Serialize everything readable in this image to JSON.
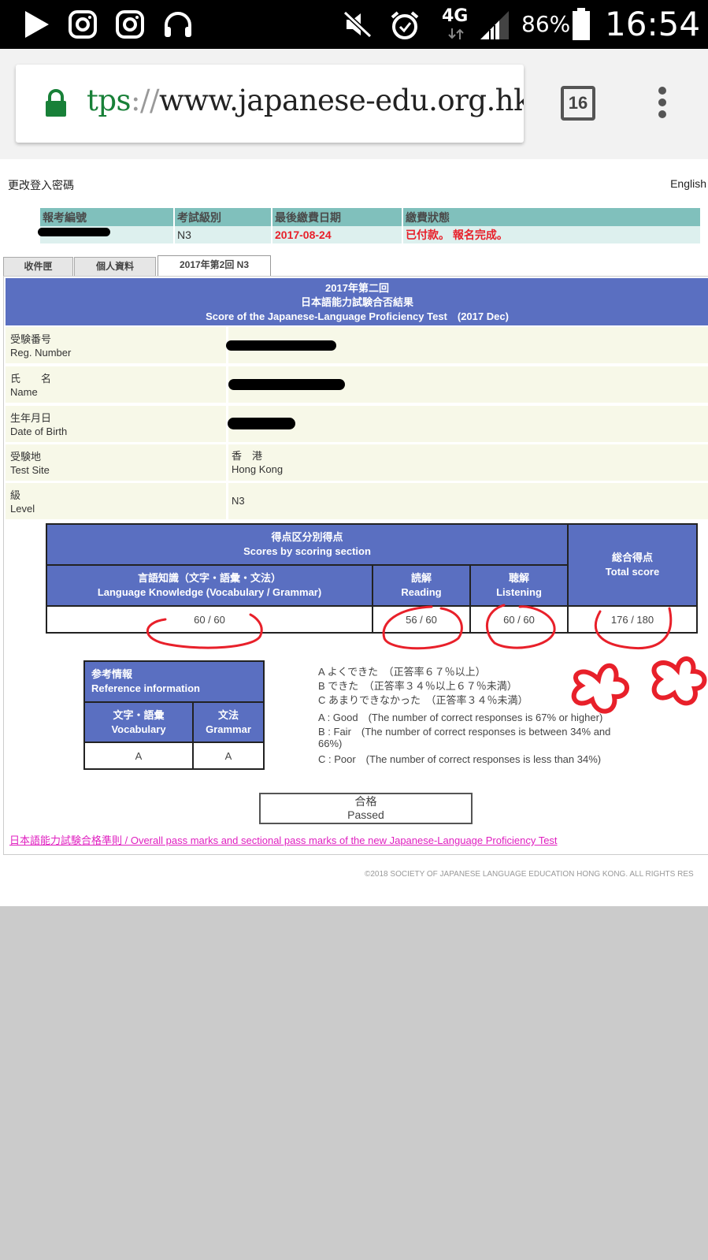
{
  "status_bar": {
    "time": "16:54",
    "battery": "86%",
    "network": "4G"
  },
  "browser": {
    "url_scheme": "tps",
    "url_sep": "://",
    "url_host": "www.japanese-edu.org.hk",
    "tab_count": "16"
  },
  "nav": {
    "change_password": "更改登入密碼",
    "language": "English"
  },
  "summary": {
    "headers": [
      "報考編號",
      "考試級別",
      "最後繳費日期",
      "繳費狀態"
    ],
    "level": "N3",
    "due_date": "2017-08-24",
    "status": "已付款。 報名完成。"
  },
  "tabs": [
    "收件匣",
    "個人資料",
    "2017年第2回 N3"
  ],
  "result": {
    "title_line1": "2017年第二回",
    "title_line2": "日本語能力試験合否結果",
    "title_line3": "Score of the Japanese-Language Proficiency Test　(2017 Dec)",
    "rows": [
      {
        "label_jp": "受験番号",
        "label_en": "Reg. Number",
        "value_1": "",
        "value_2": ""
      },
      {
        "label_jp": "氏　　名",
        "label_en": "Name",
        "value_1": "",
        "value_2": ""
      },
      {
        "label_jp": "生年月日",
        "label_en": "Date of Birth",
        "value_1": "",
        "value_2": ""
      },
      {
        "label_jp": "受験地",
        "label_en": "Test Site",
        "value_1": "香　港",
        "value_2": "Hong Kong"
      },
      {
        "label_jp": "級",
        "label_en": "Level",
        "value_1": "N3",
        "value_2": ""
      }
    ]
  },
  "scores": {
    "section_header_jp": "得点区分別得点",
    "section_header_en": "Scores by scoring section",
    "total_header_jp": "総合得点",
    "total_header_en": "Total score",
    "lang_jp": "言語知識（文字・語彙・文法）",
    "lang_en": "Language Knowledge (Vocabulary / Grammar)",
    "reading_jp": "読解",
    "reading_en": "Reading",
    "listening_jp": "聴解",
    "listening_en": "Listening",
    "lang_score": "60 / 60",
    "reading_score": "56 / 60",
    "listening_score": "60 / 60",
    "total_score": "176 / 180"
  },
  "reference": {
    "header_jp": "参考情報",
    "header_en": "Reference information",
    "vocab_jp": "文字・語彙",
    "vocab_en": "Vocabulary",
    "grammar_jp": "文法",
    "grammar_en": "Grammar",
    "vocab_grade": "A",
    "grammar_grade": "A"
  },
  "legend": {
    "jp_a": "A よくできた　（正答率６７％以上）",
    "jp_b": "B できた　（正答率３４％以上６７％未満）",
    "jp_c": "C あまりできなかった　（正答率３４％未満）",
    "en_a": "A : Good　(The number of correct responses is 67% or higher)",
    "en_b1": "B : Fair　(The number of correct responses is between 34% and",
    "en_b2": "66%)",
    "en_c": "C : Poor　(The number of correct responses is less than 34%)"
  },
  "pass": {
    "jp": "合格",
    "en": "Passed"
  },
  "pass_link": "日本語能力試験合格準則 / Overall pass marks and sectional pass marks of the new Japanese-Language Proficiency Test",
  "footer": "©2018 SOCIETY OF JAPANESE LANGUAGE EDUCATION HONG KONG. ALL RIGHTS RES",
  "colors": {
    "header_blue": "#5a6fc1",
    "teal": "#80c0bc",
    "alert_red": "#e8202a",
    "link_magenta": "#e020c0",
    "annotation_red": "#e8202a"
  }
}
